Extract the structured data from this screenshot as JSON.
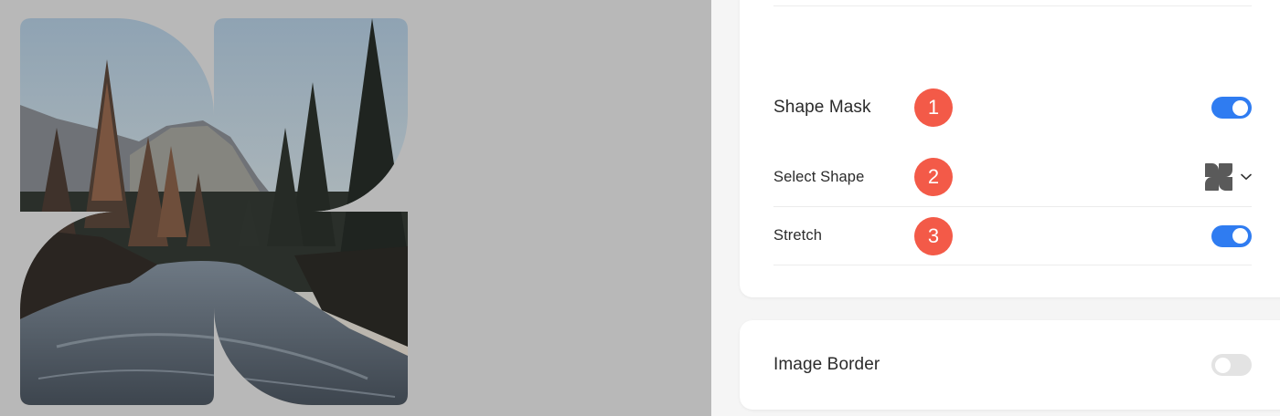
{
  "settings": {
    "shape_mask": {
      "label": "Shape Mask",
      "badge": "1",
      "enabled": true
    },
    "select_shape": {
      "label": "Select Shape",
      "badge": "2",
      "icon": "clover-shape-icon"
    },
    "stretch": {
      "label": "Stretch",
      "badge": "3",
      "enabled": true
    },
    "image_border": {
      "label": "Image Border",
      "enabled": false
    }
  },
  "colors": {
    "badge": "#f35a48",
    "toggle_on": "#2f7cf1",
    "toggle_off": "#e3e3e3",
    "canvas": "#b8b8b8"
  }
}
